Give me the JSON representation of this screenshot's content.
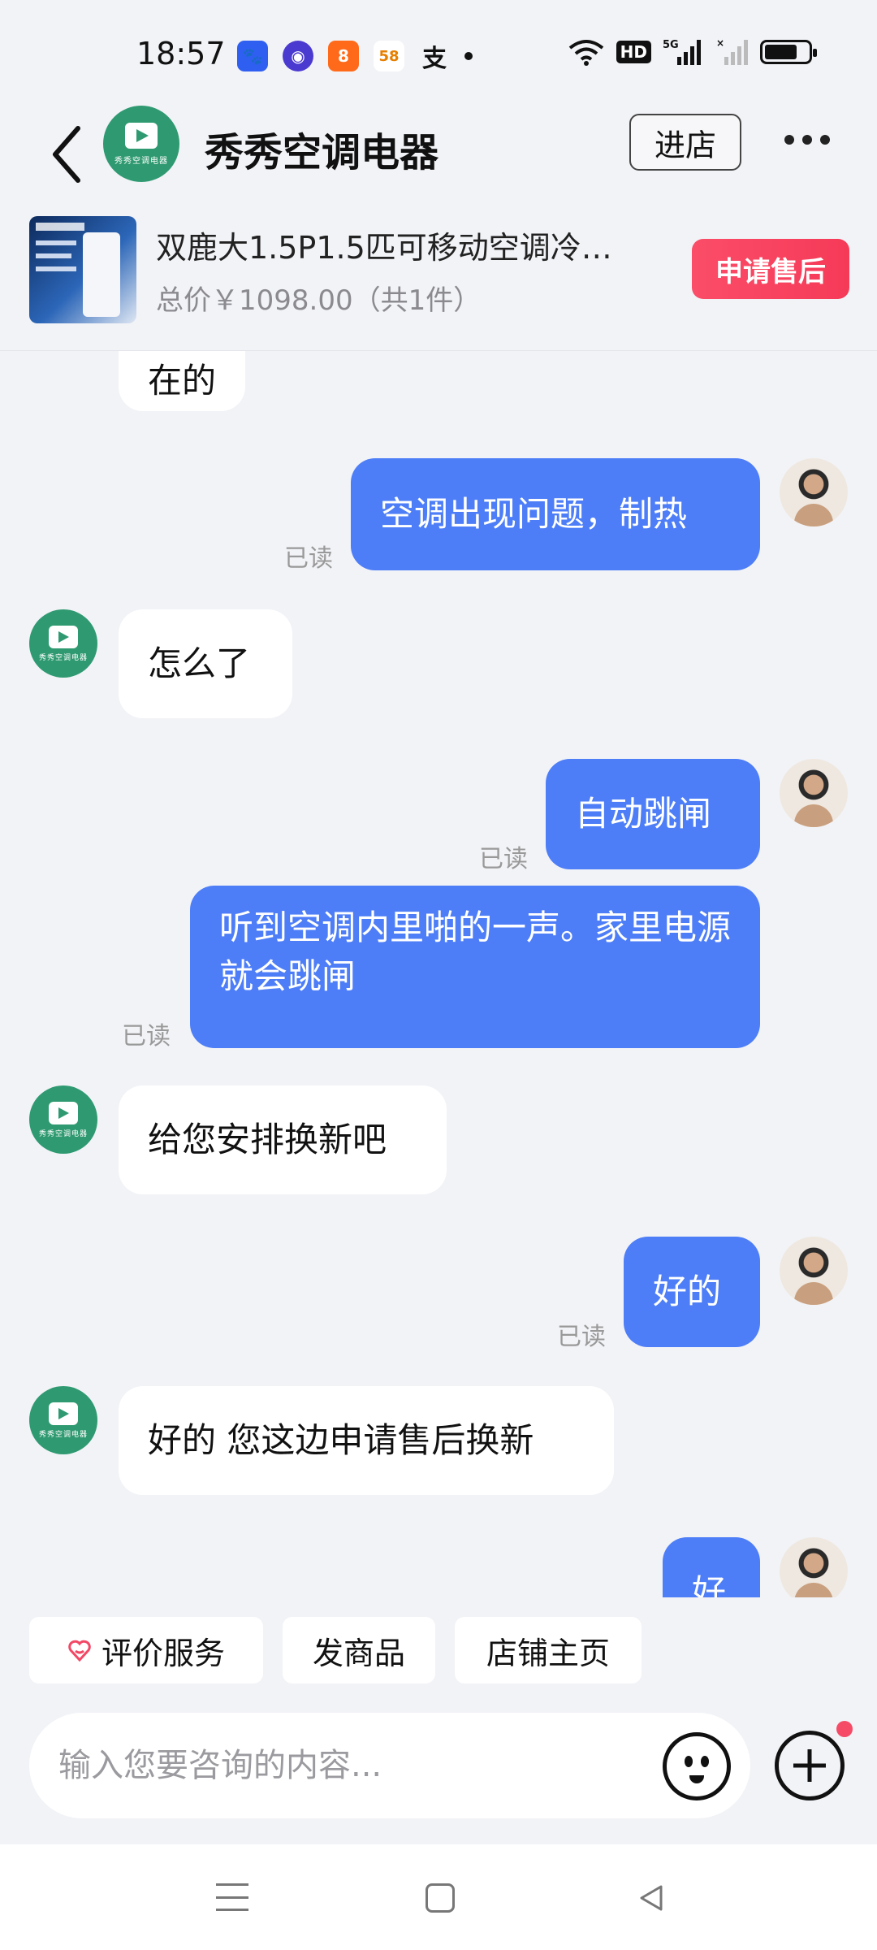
{
  "status_bar": {
    "time": "18:57",
    "hd_label": "HD",
    "network_label": "5G",
    "battery_level": 0.75,
    "app_icons": [
      {
        "name": "baidu-app-icon",
        "glyph": "🐾",
        "color": "#2f5ff0"
      },
      {
        "name": "browser-app-icon",
        "glyph": "◉",
        "color": "#4b3ad0"
      },
      {
        "name": "kuaishou-app-icon",
        "glyph": "8",
        "color": "#ff6a1a"
      },
      {
        "name": "app-58-icon",
        "glyph": "58",
        "color": "#f5a623"
      },
      {
        "name": "alipay-app-icon",
        "glyph": "支",
        "color": "#1677ff"
      }
    ]
  },
  "header": {
    "shop_name": "秀秀空调电器",
    "logo_text": "秀秀空调电器",
    "enter_store_label": "进店"
  },
  "product": {
    "title": "双鹿大1.5P1.5匹可移动空调冷…",
    "price_text": "总价￥1098.00（共1件）",
    "after_sale_label": "申请售后"
  },
  "messages": [
    {
      "from": "shop",
      "text": "在的"
    },
    {
      "from": "user",
      "text": "空调出现问题，制热",
      "status": "已读"
    },
    {
      "from": "shop",
      "text": "怎么了"
    },
    {
      "from": "user",
      "text": "自动跳闸",
      "status": "已读"
    },
    {
      "from": "user",
      "text": "听到空调内里啪的一声。家里电源就会跳闸",
      "status": "已读"
    },
    {
      "from": "shop",
      "text": "给您安排换新吧"
    },
    {
      "from": "user",
      "text": "好的",
      "status": "已读"
    },
    {
      "from": "shop",
      "text": "好的 您这边申请售后换新"
    },
    {
      "from": "user",
      "text": "好"
    }
  ],
  "quick_actions": [
    "评价服务",
    "发商品",
    "店铺主页"
  ],
  "input": {
    "placeholder": "输入您要咨询的内容..."
  },
  "colors": {
    "outgoing_bubble": "#4d7ef7",
    "shop_brand": "#2f9a71",
    "after_sale_button": "#f53a58",
    "page_background": "#f2f3f7"
  }
}
